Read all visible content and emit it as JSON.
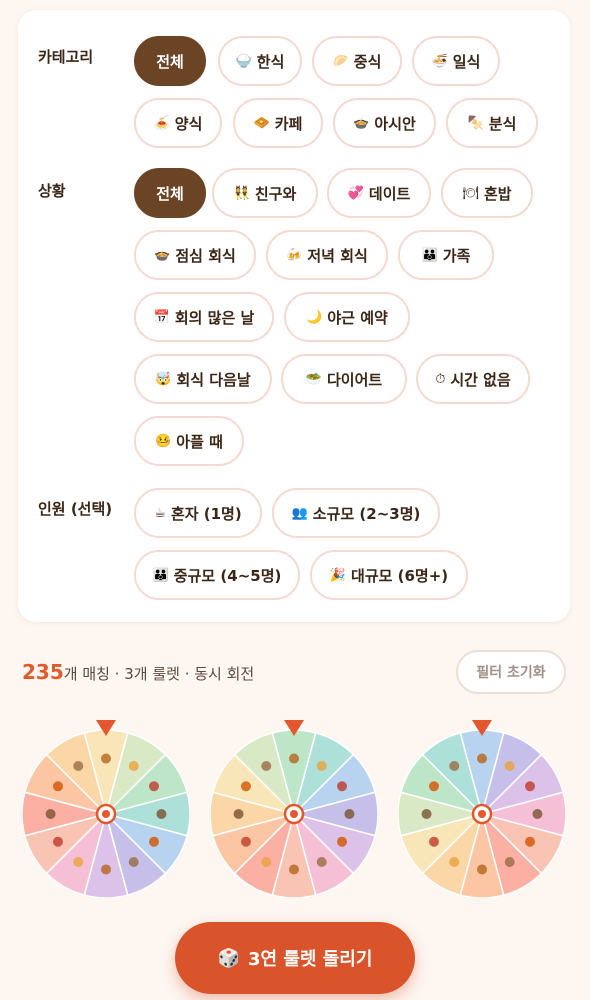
{
  "filters": {
    "category": {
      "label": "카테고리",
      "chips": [
        {
          "icon": "⚪",
          "text": "전체",
          "active": true
        },
        {
          "icon": "🍚",
          "text": "한식"
        },
        {
          "icon": "🥟",
          "text": "중식"
        },
        {
          "icon": "🍜",
          "text": "일식"
        },
        {
          "icon": "🍝",
          "text": "양식"
        },
        {
          "icon": "🧇",
          "text": "카페"
        },
        {
          "icon": "🍲",
          "text": "아시안"
        },
        {
          "icon": "🍢",
          "text": "분식"
        }
      ]
    },
    "situation": {
      "label": "상황",
      "chips": [
        {
          "icon": "",
          "text": "전체",
          "active": true
        },
        {
          "icon": "👯",
          "text": "친구와"
        },
        {
          "icon": "💞",
          "text": "데이트"
        },
        {
          "icon": "🍽",
          "text": "혼밥"
        },
        {
          "icon": "🍲",
          "text": "점심 회식"
        },
        {
          "icon": "🍻",
          "text": "저녁 회식"
        },
        {
          "icon": "👪",
          "text": "가족"
        },
        {
          "icon": "📅",
          "text": "회의 많은 날"
        },
        {
          "icon": "🌙",
          "text": "야근 예약"
        },
        {
          "icon": "🤯",
          "text": "회식 다음날"
        },
        {
          "icon": "🥗",
          "text": "다이어트"
        },
        {
          "icon": "⏱",
          "text": "시간 없음"
        },
        {
          "icon": "🤒",
          "text": "아플 때"
        }
      ]
    },
    "people": {
      "label": "인원 (선택)",
      "chips": [
        {
          "icon": "☕",
          "text": "혼자 (1명)"
        },
        {
          "icon": "👥",
          "text": "소규모 (2~3명)"
        },
        {
          "icon": "👪",
          "text": "중규모 (4~5명)"
        },
        {
          "icon": "🎉",
          "text": "대규모 (6명+)"
        }
      ]
    }
  },
  "summary": {
    "count": "235",
    "text": "개 매칭 · 3개 룰렛 · 동시 회전",
    "reset_label": "필터 초기화"
  },
  "roulettes": {
    "count": 3,
    "segments_per_wheel": 12,
    "segment_colors": [
      "#f9e6b8",
      "#d9e9c6",
      "#bde6c9",
      "#aee0da",
      "#b8d3ef",
      "#c6bfe9",
      "#dcc1e8",
      "#f5c0d6",
      "#f9c4b4",
      "#fbb0a3",
      "#fcc6a4",
      "#fbd7a8"
    ],
    "pointer_color": "#e4572e",
    "center_color": "#e4572e"
  },
  "action": {
    "icon": "🎲",
    "label": "3연 룰렛 돌리기"
  },
  "colors": {
    "accent": "#d9532b",
    "active_chip": "#6b4426",
    "chip_border": "#f4d9d1",
    "background": "#fdf6f1"
  }
}
